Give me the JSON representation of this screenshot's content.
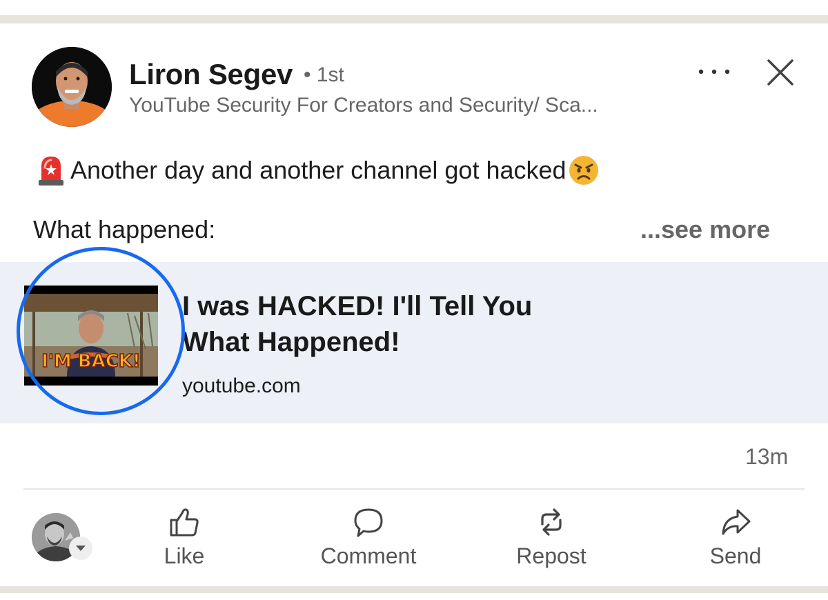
{
  "post": {
    "author": {
      "name": "Liron Segev",
      "degree": "• 1st",
      "headline": "YouTube Security For Creators and Security/ Sca..."
    },
    "text": {
      "line1": "Another day and another channel got hacked",
      "line2": "What happened:",
      "see_more": "...see more"
    },
    "link_preview": {
      "title_line1": "I was HACKED!  I'll Tell You",
      "title_line2": "What Happened!",
      "domain": "youtube.com",
      "thumbnail_text": "I'M BACK!"
    },
    "timestamp": "13m"
  },
  "actions": {
    "like": "Like",
    "comment": "Comment",
    "repost": "Repost",
    "send": "Send"
  },
  "icons": {
    "more": "more-options-icon",
    "close": "close-icon",
    "siren": "siren-emoji-icon",
    "angry": "angry-face-emoji-icon",
    "like": "thumbs-up-icon",
    "comment": "speech-bubble-icon",
    "repost": "repost-arrows-icon",
    "send": "send-arrow-icon",
    "dropdown": "chevron-down-icon"
  },
  "colors": {
    "annotation_circle": "#1769f0",
    "card_background": "#edf0f7",
    "strip": "#e8e4dc",
    "secondary_text": "#666666"
  }
}
